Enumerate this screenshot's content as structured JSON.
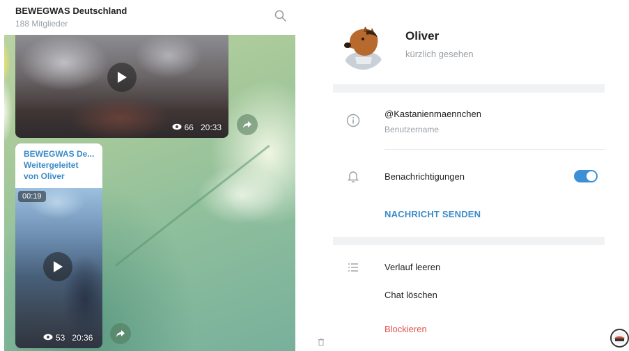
{
  "chat": {
    "title": "BEWEGWAS Deutschland",
    "members": "188 Mitglieder",
    "messages": [
      {
        "views": "66",
        "duration": "20:33"
      },
      {
        "forward_from": "BEWEGWAS De...",
        "forward_label_1": "Weitergeleitet",
        "forward_label_2": "von Oliver",
        "badge_duration": "00:19",
        "views": "53",
        "duration": "20:36"
      }
    ]
  },
  "profile": {
    "name": "Oliver",
    "last_seen": "kürzlich gesehen",
    "username": "@Kastanienmaennchen",
    "username_label": "Benutzername",
    "notifications_label": "Benachrichtigungen",
    "notifications_on": true,
    "send_message": "NACHRICHT SENDEN",
    "clear_history": "Verlauf leeren",
    "delete_chat": "Chat löschen",
    "block": "Blockieren"
  },
  "colors": {
    "accent": "#3a8bc9",
    "toggle": "#3d8fd6",
    "danger": "#e0504c",
    "muted": "#9aa0a6"
  }
}
